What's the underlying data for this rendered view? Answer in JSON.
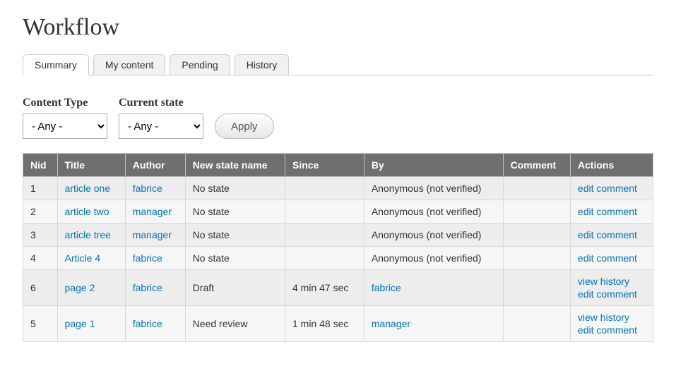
{
  "page": {
    "title": "Workflow"
  },
  "tabs": [
    {
      "label": "Summary",
      "active": true
    },
    {
      "label": "My content",
      "active": false
    },
    {
      "label": "Pending",
      "active": false
    },
    {
      "label": "History",
      "active": false
    }
  ],
  "filters": {
    "content_type": {
      "label": "Content Type",
      "selected": "- Any -",
      "options": [
        "- Any -"
      ]
    },
    "current_state": {
      "label": "Current state",
      "selected": "- Any -",
      "options": [
        "- Any -"
      ]
    },
    "apply_label": "Apply"
  },
  "table": {
    "headers": [
      "Nid",
      "Title",
      "Author",
      "New state name",
      "Since",
      "By",
      "Comment",
      "Actions"
    ],
    "rows": [
      {
        "nid": "1",
        "title": "article one",
        "author": "fabrice",
        "state": "No state",
        "since": "",
        "by": "Anonymous (not verified)",
        "by_link": false,
        "comment": "",
        "actions": [
          "edit comment"
        ]
      },
      {
        "nid": "2",
        "title": "article two",
        "author": "manager",
        "state": "No state",
        "since": "",
        "by": "Anonymous (not verified)",
        "by_link": false,
        "comment": "",
        "actions": [
          "edit comment"
        ]
      },
      {
        "nid": "3",
        "title": "article tree",
        "author": "manager",
        "state": "No state",
        "since": "",
        "by": "Anonymous (not verified)",
        "by_link": false,
        "comment": "",
        "actions": [
          "edit comment"
        ]
      },
      {
        "nid": "4",
        "title": "Article 4",
        "author": "fabrice",
        "state": "No state",
        "since": "",
        "by": "Anonymous (not verified)",
        "by_link": false,
        "comment": "",
        "actions": [
          "edit comment"
        ]
      },
      {
        "nid": "6",
        "title": "page 2",
        "author": "fabrice",
        "state": "Draft",
        "since": "4 min 47 sec",
        "by": "fabrice",
        "by_link": true,
        "comment": "",
        "actions": [
          "view history",
          "edit comment"
        ]
      },
      {
        "nid": "5",
        "title": "page 1",
        "author": "fabrice",
        "state": "Need review",
        "since": "1 min 48 sec",
        "by": "manager",
        "by_link": true,
        "comment": "",
        "actions": [
          "view history",
          "edit comment"
        ]
      }
    ]
  }
}
